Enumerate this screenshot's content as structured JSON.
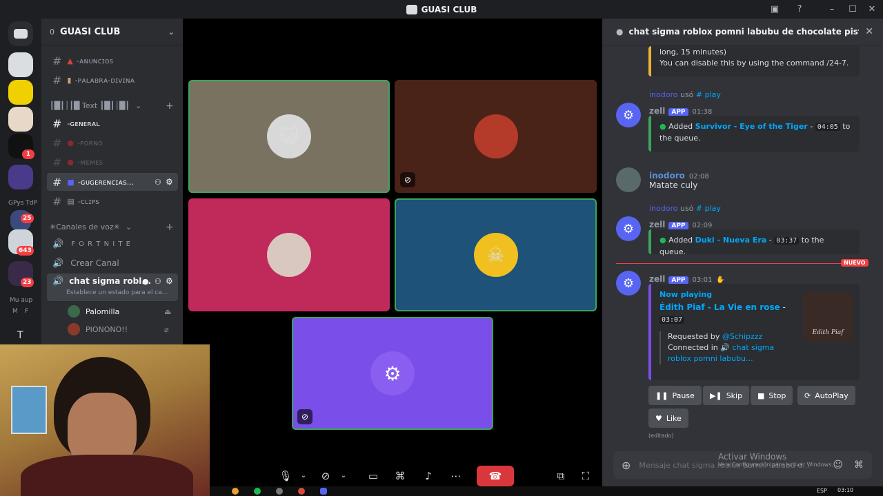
{
  "window": {
    "title": "GUASI CLUB"
  },
  "rail": {
    "badges": [
      "1",
      "25",
      "643",
      "23"
    ],
    "labels": [
      "GPys TdP",
      "Mu aup",
      "M",
      "F",
      "T"
    ]
  },
  "guild": {
    "name": "GUASI CLUB",
    "boost_count": "0",
    "channels": [
      {
        "label": "-ᴀɴᴜɴᴄɪᴏs"
      },
      {
        "label": "-ᴘᴀʟᴀʙʀᴀ-ᴅɪᴠɪɴᴀ"
      }
    ],
    "text_category": "┃█┃│┃█ Text ┃█┃│█┃",
    "text_channels": [
      {
        "label": "-ɢᴇɴᴇʀᴀʟ"
      },
      {
        "label": "-ᴘᴏʀɴᴏ"
      },
      {
        "label": "-ᴍᴇᴍᴇs"
      },
      {
        "label": "-ɢᴜɢᴇʀᴇɴᴄɪᴀs..."
      },
      {
        "label": "-ᴄʟɪᴘs"
      }
    ],
    "voice_category": "✳Canales de voz✳",
    "voice_channels": [
      {
        "label": "F O R T N I T E"
      },
      {
        "label": "Crear Canal"
      },
      {
        "label": "chat sigma robl..."
      }
    ],
    "voice_status": "Establece un estado para el ca...",
    "voice_members": [
      {
        "name": "Palomilla"
      },
      {
        "name": "PIONONO!!"
      }
    ]
  },
  "chat": {
    "header": "chat sigma roblox pomni labubu de chocolate pistachio",
    "prev_embed": {
      "line1": "long, 15 minutes)",
      "line2": "You can disable this by using the command /24-7."
    },
    "messages": [
      {
        "reply_user": "inodoro",
        "reply_verb": "usó",
        "reply_cmd": "# play",
        "author": "zell",
        "badge": "APP",
        "time": "01:38",
        "pre": "Added ",
        "track": "Survivor - Eye of the Tiger",
        "sep": " - ",
        "duration": "04:05",
        "post": " to the queue."
      },
      {
        "author": "inodoro",
        "time": "02:08",
        "text": "Matate culy"
      },
      {
        "reply_user": "inodoro",
        "reply_verb": "usó",
        "reply_cmd": "# play",
        "author": "zell",
        "badge": "APP",
        "time": "02:09",
        "pre": "Added ",
        "track": "Duki - Nueva Era",
        "sep": " - ",
        "duration": "03:37",
        "post": " to the queue."
      }
    ],
    "new_label": "NUEVO",
    "now_playing": {
      "author": "zell",
      "badge": "APP",
      "time": "03:01",
      "heading": "Now playing",
      "track": "Édith Piaf - La Vie en rose",
      "sep": " - ",
      "duration": "03:07",
      "requested_by_label": "Requested by",
      "requested_by": "@Schipzzz",
      "connected_label": "Connected in",
      "connected_channel": "chat sigma roblox pomni labubu...",
      "album_text": "Edith Piaf"
    },
    "buttons": {
      "pause": "Pause",
      "skip": "Skip",
      "stop": "Stop",
      "autoplay": "AutoPlay",
      "like": "Like"
    },
    "edited": "(editado)",
    "composer_placeholder": "Mensaje chat sigma roblox pomni labubu d...",
    "activate_windows": "Activar Windows",
    "activate_windows_sub": "Ve a Configuración para activar Windows."
  },
  "taskbar": {
    "lang": "ESP",
    "time": "03:10"
  },
  "colors": {
    "accent": "#5865f2",
    "speaking": "#3ba55d",
    "danger": "#da373c",
    "link": "#00a8fc"
  }
}
